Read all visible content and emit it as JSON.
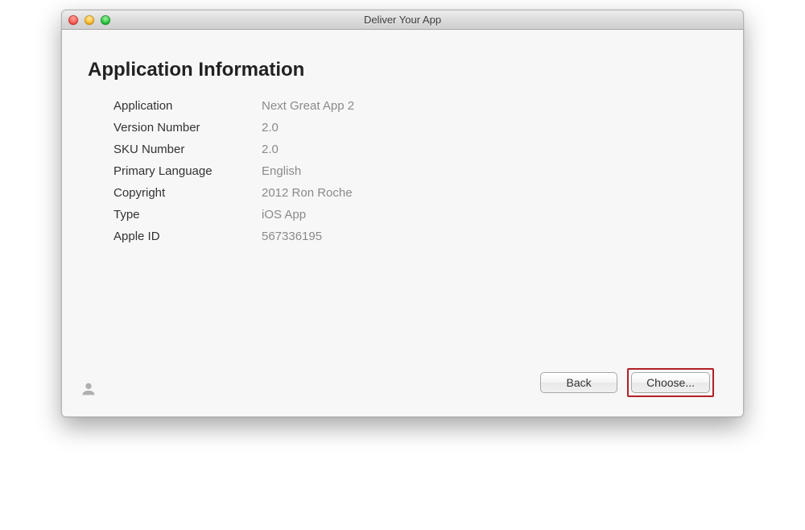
{
  "window": {
    "title": "Deliver Your App"
  },
  "heading": "Application Information",
  "fields": [
    {
      "label": "Application",
      "value": "Next Great App 2"
    },
    {
      "label": "Version Number",
      "value": "2.0"
    },
    {
      "label": "SKU Number",
      "value": "2.0"
    },
    {
      "label": "Primary Language",
      "value": "English"
    },
    {
      "label": "Copyright",
      "value": "2012 Ron Roche"
    },
    {
      "label": "Type",
      "value": "iOS App"
    },
    {
      "label": "Apple ID",
      "value": "567336195"
    }
  ],
  "buttons": {
    "back": "Back",
    "choose": "Choose..."
  }
}
